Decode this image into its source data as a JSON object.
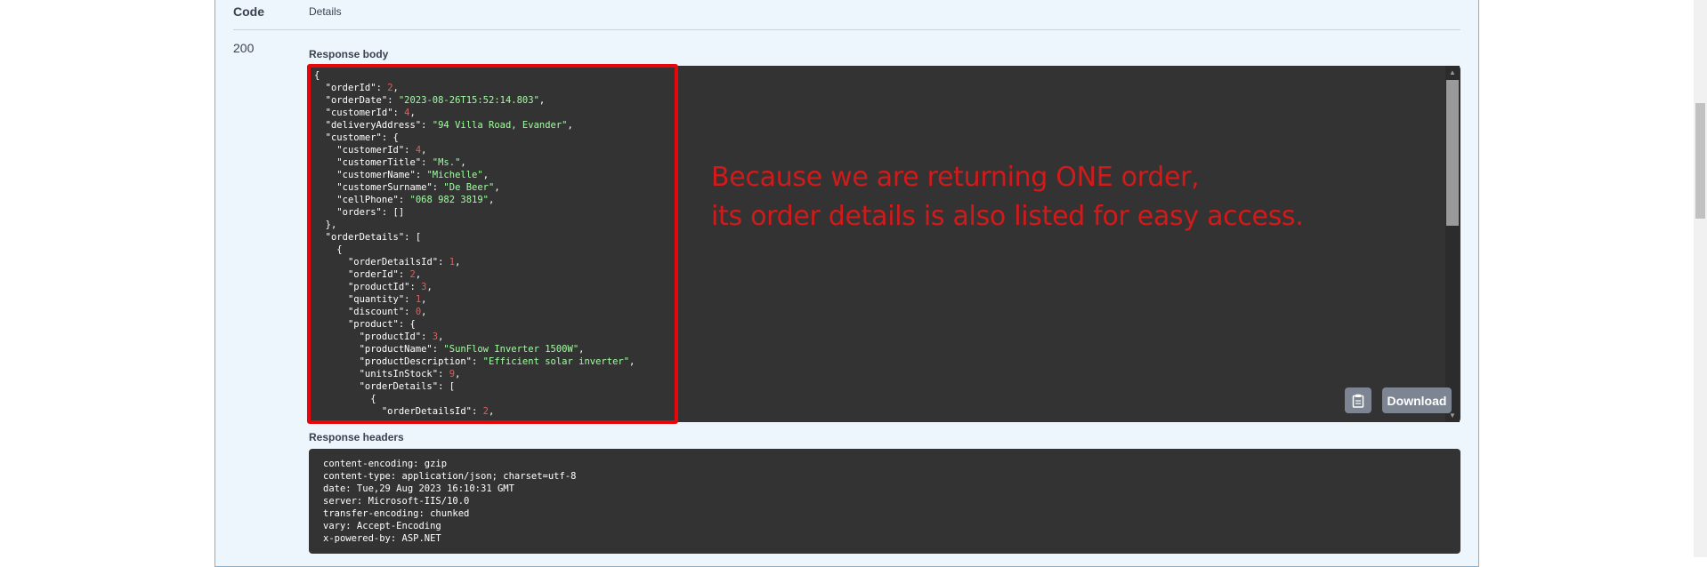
{
  "table_header": {
    "code": "Code",
    "details": "Details"
  },
  "response": {
    "code": "200",
    "body_label": "Response body",
    "headers_label": "Response headers",
    "download_label": "Download",
    "headers": [
      "content-encoding: gzip",
      "content-type: application/json; charset=utf-8",
      "date: Tue,29 Aug 2023 16:10:31 GMT",
      "server: Microsoft-IIS/10.0",
      "transfer-encoding: chunked",
      "vary: Accept-Encoding",
      "x-powered-by: ASP.NET"
    ],
    "body_lines": [
      [
        {
          "t": "p",
          "v": "{"
        }
      ],
      [
        {
          "t": "p",
          "v": "  "
        },
        {
          "t": "k",
          "v": "\"orderId\""
        },
        {
          "t": "p",
          "v": ": "
        },
        {
          "t": "n",
          "v": "2"
        },
        {
          "t": "p",
          "v": ","
        }
      ],
      [
        {
          "t": "p",
          "v": "  "
        },
        {
          "t": "k",
          "v": "\"orderDate\""
        },
        {
          "t": "p",
          "v": ": "
        },
        {
          "t": "s",
          "v": "\"2023-08-26T15:52:14.803\""
        },
        {
          "t": "p",
          "v": ","
        }
      ],
      [
        {
          "t": "p",
          "v": "  "
        },
        {
          "t": "k",
          "v": "\"customerId\""
        },
        {
          "t": "p",
          "v": ": "
        },
        {
          "t": "n",
          "v": "4"
        },
        {
          "t": "p",
          "v": ","
        }
      ],
      [
        {
          "t": "p",
          "v": "  "
        },
        {
          "t": "k",
          "v": "\"deliveryAddress\""
        },
        {
          "t": "p",
          "v": ": "
        },
        {
          "t": "s",
          "v": "\"94 Villa Road, Evander\""
        },
        {
          "t": "p",
          "v": ","
        }
      ],
      [
        {
          "t": "p",
          "v": "  "
        },
        {
          "t": "k",
          "v": "\"customer\""
        },
        {
          "t": "p",
          "v": ": {"
        }
      ],
      [
        {
          "t": "p",
          "v": "    "
        },
        {
          "t": "k",
          "v": "\"customerId\""
        },
        {
          "t": "p",
          "v": ": "
        },
        {
          "t": "n",
          "v": "4"
        },
        {
          "t": "p",
          "v": ","
        }
      ],
      [
        {
          "t": "p",
          "v": "    "
        },
        {
          "t": "k",
          "v": "\"customerTitle\""
        },
        {
          "t": "p",
          "v": ": "
        },
        {
          "t": "s",
          "v": "\"Ms.\""
        },
        {
          "t": "p",
          "v": ","
        }
      ],
      [
        {
          "t": "p",
          "v": "    "
        },
        {
          "t": "k",
          "v": "\"customerName\""
        },
        {
          "t": "p",
          "v": ": "
        },
        {
          "t": "s",
          "v": "\"Michelle\""
        },
        {
          "t": "p",
          "v": ","
        }
      ],
      [
        {
          "t": "p",
          "v": "    "
        },
        {
          "t": "k",
          "v": "\"customerSurname\""
        },
        {
          "t": "p",
          "v": ": "
        },
        {
          "t": "s",
          "v": "\"De Beer\""
        },
        {
          "t": "p",
          "v": ","
        }
      ],
      [
        {
          "t": "p",
          "v": "    "
        },
        {
          "t": "k",
          "v": "\"cellPhone\""
        },
        {
          "t": "p",
          "v": ": "
        },
        {
          "t": "s",
          "v": "\"068 982 3819\""
        },
        {
          "t": "p",
          "v": ","
        }
      ],
      [
        {
          "t": "p",
          "v": "    "
        },
        {
          "t": "k",
          "v": "\"orders\""
        },
        {
          "t": "p",
          "v": ": []"
        }
      ],
      [
        {
          "t": "p",
          "v": "  },"
        }
      ],
      [
        {
          "t": "p",
          "v": "  "
        },
        {
          "t": "k",
          "v": "\"orderDetails\""
        },
        {
          "t": "p",
          "v": ": ["
        }
      ],
      [
        {
          "t": "p",
          "v": "    {"
        }
      ],
      [
        {
          "t": "p",
          "v": "      "
        },
        {
          "t": "k",
          "v": "\"orderDetailsId\""
        },
        {
          "t": "p",
          "v": ": "
        },
        {
          "t": "n",
          "v": "1"
        },
        {
          "t": "p",
          "v": ","
        }
      ],
      [
        {
          "t": "p",
          "v": "      "
        },
        {
          "t": "k",
          "v": "\"orderId\""
        },
        {
          "t": "p",
          "v": ": "
        },
        {
          "t": "n",
          "v": "2"
        },
        {
          "t": "p",
          "v": ","
        }
      ],
      [
        {
          "t": "p",
          "v": "      "
        },
        {
          "t": "k",
          "v": "\"productId\""
        },
        {
          "t": "p",
          "v": ": "
        },
        {
          "t": "n",
          "v": "3"
        },
        {
          "t": "p",
          "v": ","
        }
      ],
      [
        {
          "t": "p",
          "v": "      "
        },
        {
          "t": "k",
          "v": "\"quantity\""
        },
        {
          "t": "p",
          "v": ": "
        },
        {
          "t": "n",
          "v": "1"
        },
        {
          "t": "p",
          "v": ","
        }
      ],
      [
        {
          "t": "p",
          "v": "      "
        },
        {
          "t": "k",
          "v": "\"discount\""
        },
        {
          "t": "p",
          "v": ": "
        },
        {
          "t": "n",
          "v": "0"
        },
        {
          "t": "p",
          "v": ","
        }
      ],
      [
        {
          "t": "p",
          "v": "      "
        },
        {
          "t": "k",
          "v": "\"product\""
        },
        {
          "t": "p",
          "v": ": {"
        }
      ],
      [
        {
          "t": "p",
          "v": "        "
        },
        {
          "t": "k",
          "v": "\"productId\""
        },
        {
          "t": "p",
          "v": ": "
        },
        {
          "t": "n",
          "v": "3"
        },
        {
          "t": "p",
          "v": ","
        }
      ],
      [
        {
          "t": "p",
          "v": "        "
        },
        {
          "t": "k",
          "v": "\"productName\""
        },
        {
          "t": "p",
          "v": ": "
        },
        {
          "t": "s",
          "v": "\"SunFlow Inverter 1500W\""
        },
        {
          "t": "p",
          "v": ","
        }
      ],
      [
        {
          "t": "p",
          "v": "        "
        },
        {
          "t": "k",
          "v": "\"productDescription\""
        },
        {
          "t": "p",
          "v": ": "
        },
        {
          "t": "s",
          "v": "\"Efficient solar inverter\""
        },
        {
          "t": "p",
          "v": ","
        }
      ],
      [
        {
          "t": "p",
          "v": "        "
        },
        {
          "t": "k",
          "v": "\"unitsInStock\""
        },
        {
          "t": "p",
          "v": ": "
        },
        {
          "t": "n",
          "v": "9"
        },
        {
          "t": "p",
          "v": ","
        }
      ],
      [
        {
          "t": "p",
          "v": "        "
        },
        {
          "t": "k",
          "v": "\"orderDetails\""
        },
        {
          "t": "p",
          "v": ": ["
        }
      ],
      [
        {
          "t": "p",
          "v": "          {"
        }
      ],
      [
        {
          "t": "p",
          "v": "            "
        },
        {
          "t": "k",
          "v": "\"orderDetailsId\""
        },
        {
          "t": "p",
          "v": ": "
        },
        {
          "t": "n",
          "v": "2"
        },
        {
          "t": "p",
          "v": ","
        }
      ]
    ]
  },
  "annotation": {
    "line1": "Because we are returning ONE order,",
    "line2": "its order details is also listed for easy access.",
    "color": "#d11a1a"
  },
  "colors": {
    "highlight_border": "#e8060b",
    "code_bg": "#333333",
    "card_bg": "#eef6fd"
  },
  "icons": {
    "copy": "clipboard-icon",
    "scroll_up": "arrow-up-icon",
    "scroll_down": "arrow-down-icon"
  }
}
